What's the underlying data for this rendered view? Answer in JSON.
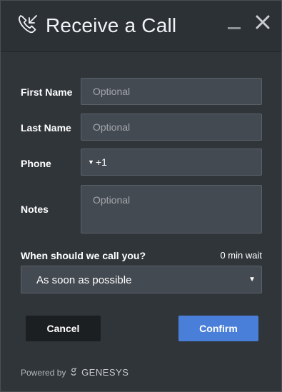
{
  "window": {
    "title": "Receive a Call",
    "title_icon": "incoming-call-icon",
    "minimize_icon": "minimize-icon",
    "close_icon": "close-icon"
  },
  "form": {
    "first_name": {
      "label": "First Name",
      "placeholder": "Optional",
      "value": ""
    },
    "last_name": {
      "label": "Last Name",
      "placeholder": "Optional",
      "value": ""
    },
    "phone": {
      "label": "Phone",
      "country_code": "+1",
      "value": "+1"
    },
    "notes": {
      "label": "Notes",
      "placeholder": "Optional",
      "value": ""
    }
  },
  "schedule": {
    "question": "When should we call you?",
    "wait": "0 min wait",
    "selected": "As soon as possible"
  },
  "actions": {
    "cancel": "Cancel",
    "confirm": "Confirm"
  },
  "footer": {
    "powered_by": "Powered by",
    "brand": "GENESYS"
  },
  "colors": {
    "background": "#30353a",
    "header": "#2c3136",
    "field": "#444a51",
    "cancel_button": "#1c1f22",
    "confirm_button": "#4a7fd9"
  }
}
